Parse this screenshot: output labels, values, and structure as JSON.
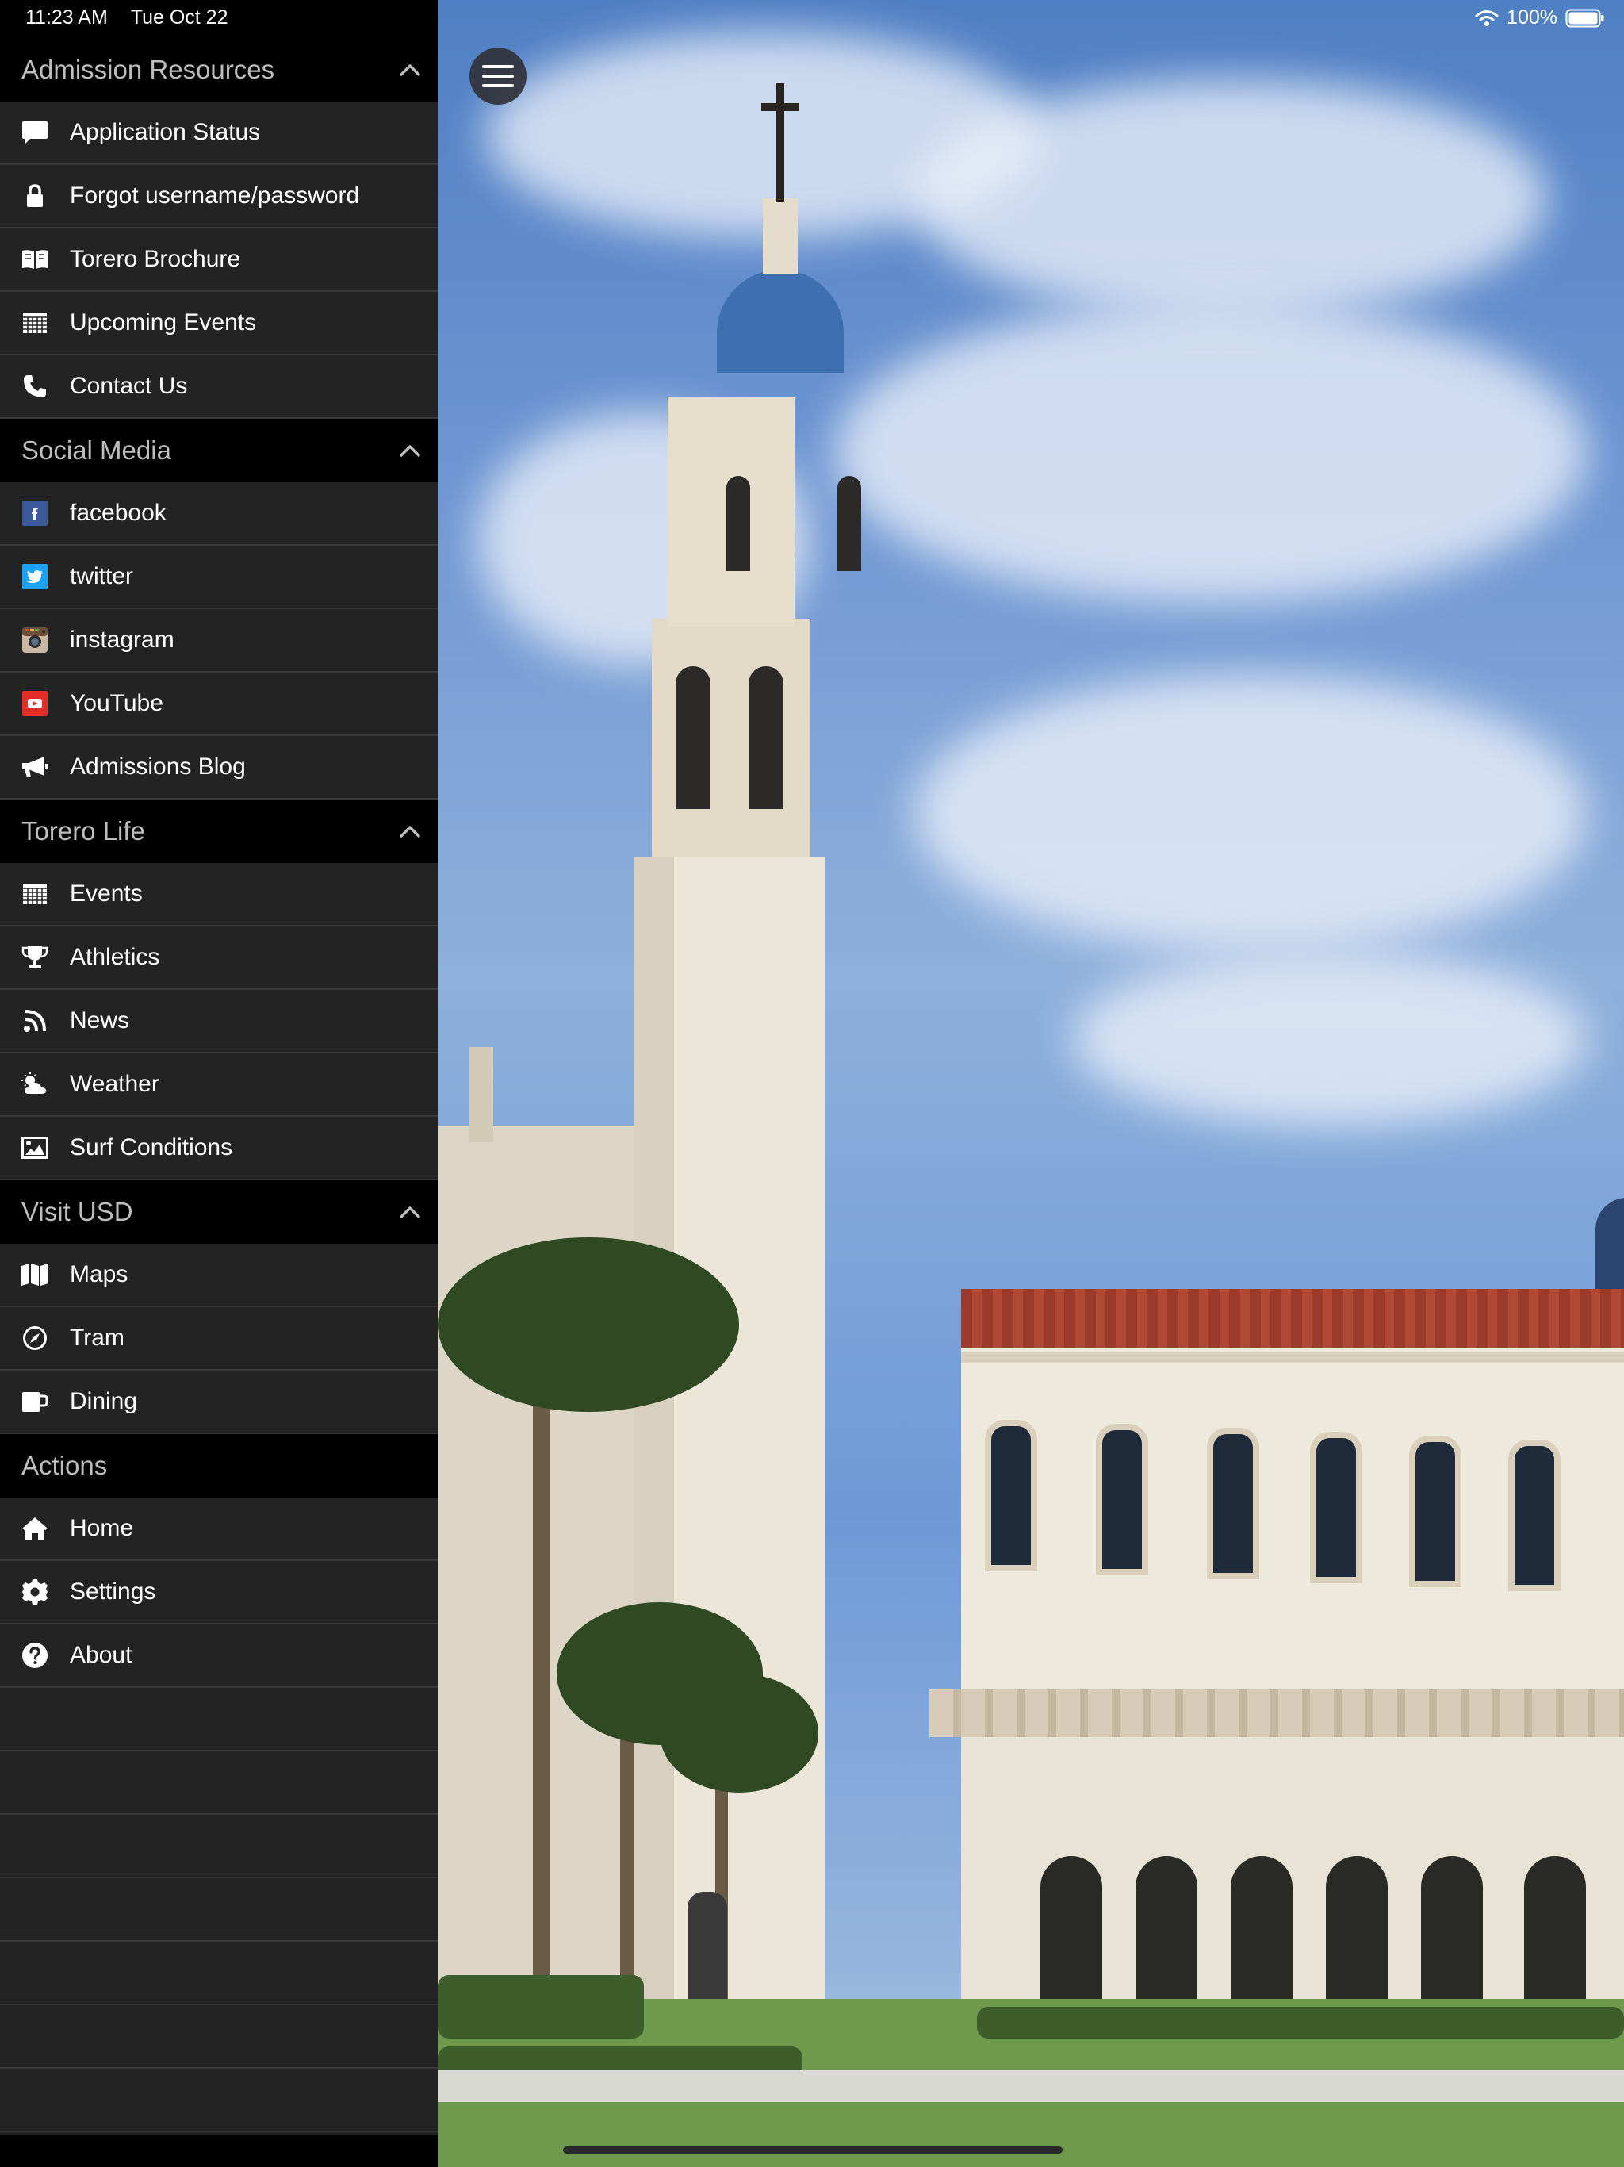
{
  "status_bar": {
    "time": "11:23 AM",
    "date": "Tue Oct 22",
    "battery": "100%"
  },
  "sidebar": {
    "sections": [
      {
        "title": "Admission Resources",
        "items": [
          {
            "label": "Application Status",
            "icon": "speech-bubble-icon"
          },
          {
            "label": "Forgot username/password",
            "icon": "lock-icon"
          },
          {
            "label": "Torero Brochure",
            "icon": "book-icon"
          },
          {
            "label": "Upcoming Events",
            "icon": "calendar-grid-icon"
          },
          {
            "label": "Contact Us",
            "icon": "phone-icon"
          }
        ]
      },
      {
        "title": "Social Media",
        "items": [
          {
            "label": "facebook",
            "icon": "facebook-icon"
          },
          {
            "label": "twitter",
            "icon": "twitter-icon"
          },
          {
            "label": "instagram",
            "icon": "instagram-icon"
          },
          {
            "label": "YouTube",
            "icon": "youtube-icon"
          },
          {
            "label": "Admissions Blog",
            "icon": "megaphone-icon"
          }
        ]
      },
      {
        "title": "Torero Life",
        "items": [
          {
            "label": "Events",
            "icon": "calendar-grid-icon"
          },
          {
            "label": "Athletics",
            "icon": "trophy-icon"
          },
          {
            "label": "News",
            "icon": "rss-icon"
          },
          {
            "label": "Weather",
            "icon": "weather-icon"
          },
          {
            "label": "Surf Conditions",
            "icon": "picture-icon"
          }
        ]
      },
      {
        "title": "Visit USD",
        "items": [
          {
            "label": "Maps",
            "icon": "map-icon"
          },
          {
            "label": "Tram",
            "icon": "compass-icon"
          },
          {
            "label": "Dining",
            "icon": "mug-icon"
          }
        ]
      },
      {
        "title": "Actions",
        "items": [
          {
            "label": "Home",
            "icon": "home-icon"
          },
          {
            "label": "Settings",
            "icon": "gear-icon"
          },
          {
            "label": "About",
            "icon": "question-icon"
          }
        ]
      }
    ]
  },
  "colors": {
    "sidebar_bg": "#232323",
    "section_header_bg": "#000000",
    "section_title": "#bdbdbd",
    "item_text": "#ffffff",
    "facebook": "#3b5998",
    "twitter": "#1da1f2",
    "youtube": "#e52d27"
  }
}
